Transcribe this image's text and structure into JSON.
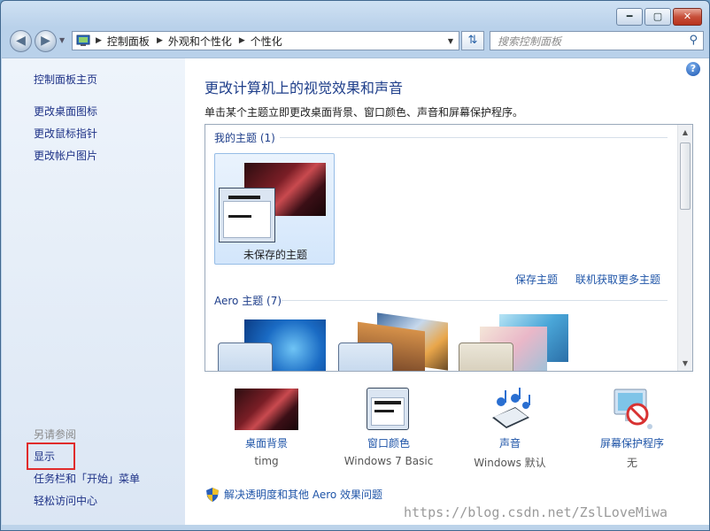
{
  "window": {
    "controls": {
      "minimize": "━",
      "maximize": "▢",
      "close": "✕"
    }
  },
  "nav": {
    "back_icon": "arrow-left",
    "forward_icon": "arrow-right"
  },
  "breadcrumb": {
    "root": "控制面板",
    "level2": "外观和个性化",
    "level3": "个性化"
  },
  "search": {
    "placeholder": "搜索控制面板"
  },
  "sidebar": {
    "home": "控制面板主页",
    "items": [
      "更改桌面图标",
      "更改鼠标指针",
      "更改帐户图片"
    ],
    "see_also": "另请参阅",
    "also_items": [
      "显示",
      "任务栏和「开始」菜单",
      "轻松访问中心"
    ]
  },
  "main": {
    "title": "更改计算机上的视觉效果和声音",
    "subtitle": "单击某个主题立即更改桌面背景、窗口颜色、声音和屏幕保护程序。",
    "my_themes": "我的主题 (1)",
    "unsaved_theme": "未保存的主题",
    "save_theme": "保存主题",
    "get_more": "联机获取更多主题",
    "aero_themes": "Aero 主题 (7)"
  },
  "bottom": [
    {
      "label": "桌面背景",
      "value": "timg"
    },
    {
      "label": "窗口颜色",
      "value": "Windows 7 Basic"
    },
    {
      "label": "声音",
      "value": "Windows 默认"
    },
    {
      "label": "屏幕保护程序",
      "value": "无"
    }
  ],
  "fix_link": "解决透明度和其他 Aero 效果问题",
  "watermark": "https://blog.csdn.net/ZslLoveMiwa",
  "colors": {
    "link": "#1f55a8",
    "title": "#1e3e8a",
    "highlight_box": "#e02b2b"
  }
}
